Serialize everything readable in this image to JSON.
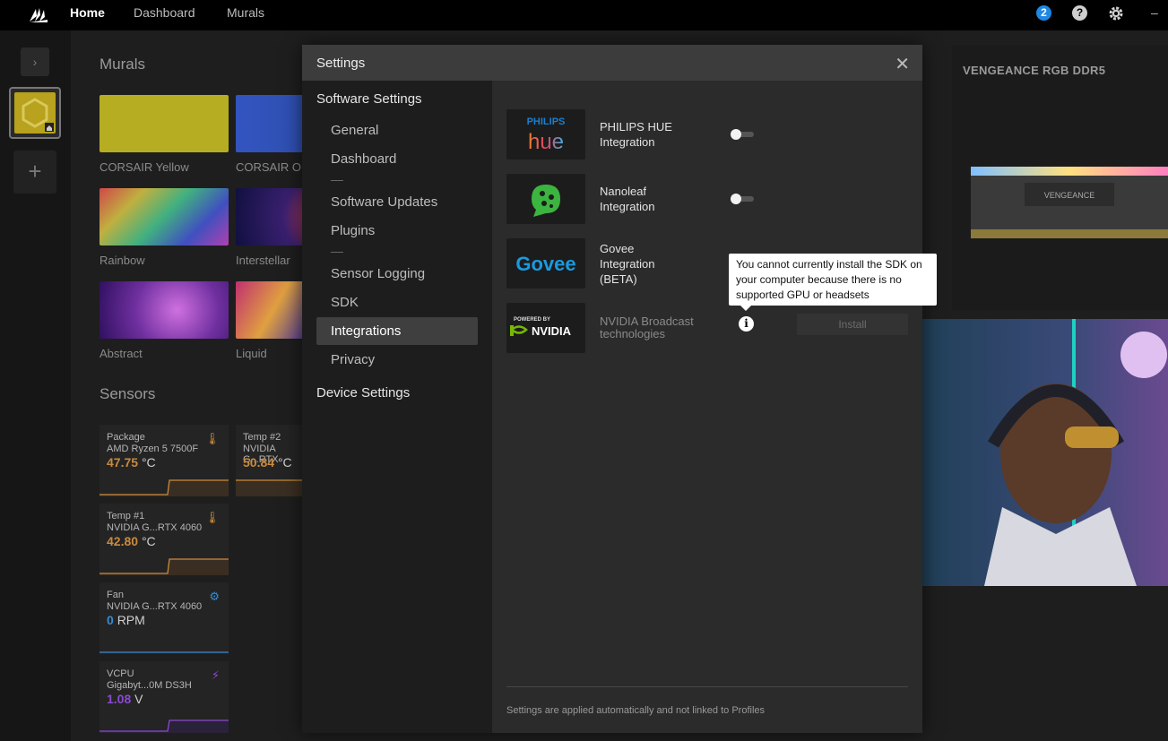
{
  "topbar": {
    "nav": [
      {
        "label": "Home",
        "active": true
      },
      {
        "label": "Dashboard",
        "active": false
      },
      {
        "label": "Murals",
        "active": false
      }
    ],
    "notification_count": "2",
    "help_glyph": "?",
    "minimize_glyph": "–"
  },
  "rail": {
    "toggle_glyph": "›",
    "add_glyph": "+"
  },
  "background": {
    "murals_title": "Murals",
    "murals": [
      {
        "label": "CORSAIR Yellow",
        "color": "#b7ad22"
      },
      {
        "label": "CORSAIR ON",
        "color": "#2a54b8"
      },
      {
        "label": "Rainbow",
        "color": "#c04040"
      },
      {
        "label": "Interstellar",
        "color": "#3a2a80"
      },
      {
        "label": "Abstract",
        "color": "#8a30b0"
      },
      {
        "label": "Liquid",
        "color": "#a04070"
      }
    ],
    "sensors_title": "Sensors",
    "sensors": [
      {
        "line1": "Package",
        "line2": "AMD Ryzen 5 7500F",
        "value": "47.75",
        "unit": "°C",
        "color": "#c98a3e",
        "icon": "thermometer-icon"
      },
      {
        "line1": "Temp #2",
        "line2": "NVIDIA G...RTX",
        "value": "50.84",
        "unit": "°C",
        "color": "#c98a3e",
        "icon": "thermometer-icon"
      },
      {
        "line1": "Temp #1",
        "line2": "NVIDIA G...RTX 4060",
        "value": "42.80",
        "unit": "°C",
        "color": "#c98a3e",
        "icon": "thermometer-icon"
      },
      {
        "line1": "Fan",
        "line2": "NVIDIA G...RTX 4060",
        "value": "0",
        "unit": "RPM",
        "color": "#3a8ad0",
        "icon": "fan-gear-icon"
      },
      {
        "line1": "VCPU",
        "line2": "Gigabyt...0M DS3H",
        "value": "1.08",
        "unit": "V",
        "color": "#8a4ad0",
        "icon": "lightning-icon"
      }
    ],
    "ram_title": "VENGEANCE RGB DDR5",
    "ram_label": "VENGEANCE"
  },
  "modal": {
    "title": "Settings",
    "close_glyph": "✕",
    "groups": {
      "software": "Software Settings",
      "device": "Device Settings"
    },
    "items": [
      {
        "label": "General"
      },
      {
        "label": "Dashboard"
      },
      {
        "label": "Software Updates"
      },
      {
        "label": "Plugins"
      },
      {
        "label": "Sensor Logging"
      },
      {
        "label": "SDK"
      },
      {
        "label": "Integrations",
        "selected": true
      },
      {
        "label": "Privacy"
      }
    ],
    "integrations": [
      {
        "name_line1": "PHILIPS HUE",
        "name_line2": "Integration",
        "logo_top": "PHILIPS",
        "logo_main": "hue",
        "toggle": false
      },
      {
        "name_line1": "Nanoleaf",
        "name_line2": "Integration",
        "logo_main": "nanoleaf",
        "toggle": false
      },
      {
        "name_line1": "Govee",
        "name_line2": "Integration",
        "name_line3": "(BETA)",
        "logo_main": "Govee"
      },
      {
        "name_line1": "NVIDIA Broadcast",
        "name_line2": "technologies",
        "logo_top": "POWERED BY",
        "logo_main": "NVIDIA",
        "install_label": "Install"
      }
    ],
    "info_glyph": "i",
    "tooltip": "You cannot currently install the SDK on your computer because there is no supported GPU or headsets",
    "footer": "Settings are applied automatically and not linked to Profiles"
  }
}
